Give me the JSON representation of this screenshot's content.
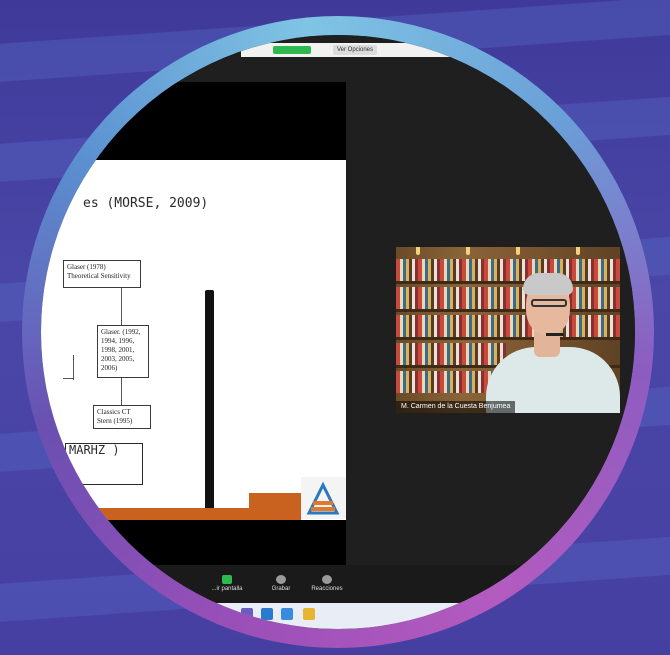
{
  "zoom": {
    "toolbar": {
      "options_label": "Ver Opciones"
    },
    "participant": {
      "name": "M. Carmen de la Cuesta Benjumea"
    },
    "controls": [
      {
        "label": "...ir pantalla",
        "icon": "share-screen-icon",
        "color": "#2fb84e"
      },
      {
        "label": "Grabar",
        "icon": "record-icon",
        "color": "#9a9a9a"
      },
      {
        "label": "Reacciones",
        "icon": "reactions-icon",
        "color": "#9a9a9a"
      }
    ]
  },
  "shared_document": {
    "heading": "es (MORSE, 2009)",
    "boxes": [
      {
        "text": "Glaser (1978) Theoretical Sensitivity"
      },
      {
        "text": "Glaser. (1992, 1994, 1996, 1998, 2001, 2003, 2005, 2006)"
      },
      {
        "text": "Classics CT Stern (1995)"
      }
    ],
    "handwriting_bottom": "MARHZ )"
  },
  "colors": {
    "background": "#4a47a8",
    "ring_gradient": [
      "#9a4fb8",
      "#5a8fd0",
      "#7fc4e4",
      "#b45bc0"
    ],
    "zoom_dark": "#1f1f1f",
    "accent_orange": "#c9621f",
    "share_green": "#2fb84e"
  }
}
